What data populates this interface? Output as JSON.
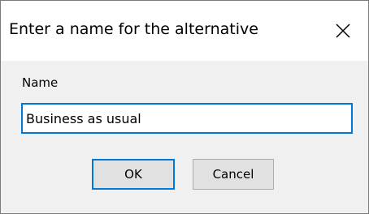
{
  "dialog": {
    "title": "Enter a name for the alternative",
    "close_icon": "close-icon",
    "name_label": "Name",
    "name_value": "Business as usual",
    "ok_label": "OK",
    "cancel_label": "Cancel"
  },
  "colors": {
    "focus_border": "#0078d7",
    "dialog_background": "#f0f0f0",
    "titlebar_background": "#ffffff",
    "button_background": "#e1e1e1",
    "button_border": "#adadad"
  }
}
